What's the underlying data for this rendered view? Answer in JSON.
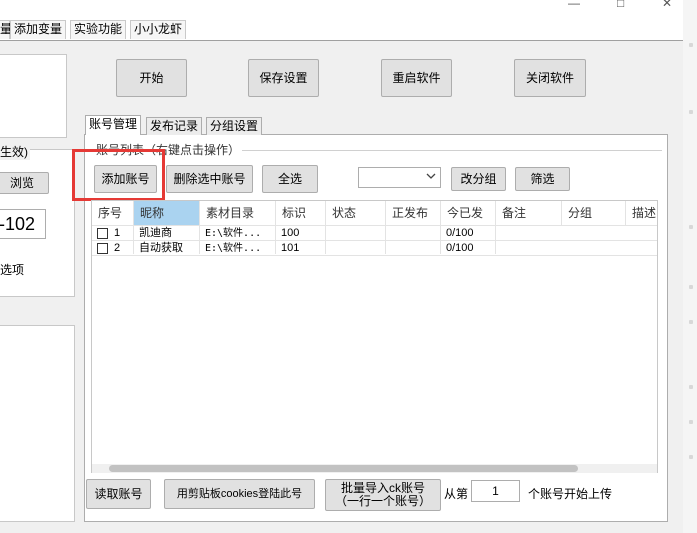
{
  "menu": {
    "items": [
      "量",
      "添加变量",
      "实验功能",
      "小小龙虾"
    ],
    "window_controls": [
      "—",
      "□",
      "✕"
    ]
  },
  "left_panel": {
    "label_effect": "生效)",
    "browse_button": "浏览",
    "value": "102",
    "value_prefix": "-",
    "option_label": "选项"
  },
  "top_buttons": {
    "start": "开始",
    "save_settings": "保存设置",
    "restart": "重启软件",
    "close": "关闭软件"
  },
  "tabs": [
    "账号管理",
    "发布记录",
    "分组设置"
  ],
  "group_title": "账号列表（右键点击操作）",
  "toolbar": {
    "add_account": "添加账号",
    "delete_selected": "删除选中账号",
    "select_all": "全选",
    "group_select_value": "",
    "change_group": "改分组",
    "filter": "筛选"
  },
  "table": {
    "columns": [
      "序号",
      "昵称",
      "素材目录",
      "标识",
      "状态",
      "正发布",
      "今已发",
      "备注",
      "分组",
      "描述"
    ],
    "rows": [
      {
        "index": "1",
        "nickname": "凯迪商",
        "dir": "E:\\软件...",
        "id": "100",
        "status": "",
        "publishing": "",
        "sent_today": "0/100",
        "note": "",
        "group": "",
        "desc": ""
      },
      {
        "index": "2",
        "nickname": "自动获取",
        "dir": "E:\\软件...",
        "id": "101",
        "status": "",
        "publishing": "",
        "sent_today": "0/100",
        "note": "",
        "group": "",
        "desc": ""
      }
    ]
  },
  "bottom": {
    "read_account": "读取账号",
    "clipboard_login": "用剪贴板cookies登陆此号",
    "bulk_import_line1": "批量导入ck账号",
    "bulk_import_line2": "（一行一个账号）",
    "from_label": "从第",
    "start_value": "1",
    "suffix_label": "个账号开始上传"
  }
}
